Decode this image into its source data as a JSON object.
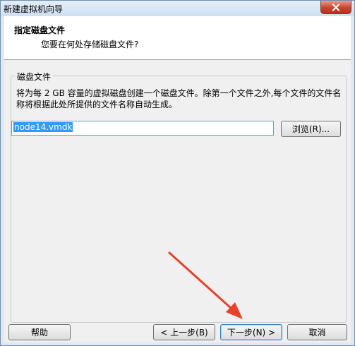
{
  "window": {
    "title": "新建虚拟机向导"
  },
  "header": {
    "title": "指定磁盘文件",
    "subtitle": "您要在何处存储磁盘文件?"
  },
  "group": {
    "legend": "磁盘文件",
    "description": "将为每 2 GB 容量的虚拟磁盘创建一个磁盘文件。除第一个文件之外,每个文件的文件名称将根据此处所提供的文件名称自动生成。"
  },
  "disk_file": {
    "value": "node14.vmdk"
  },
  "buttons": {
    "browse": "浏览(R)...",
    "help": "帮助",
    "back": "< 上一步(B)",
    "next": "下一步(N) >",
    "cancel": "取消"
  },
  "colors": {
    "annotation_arrow": "#e8412c"
  }
}
